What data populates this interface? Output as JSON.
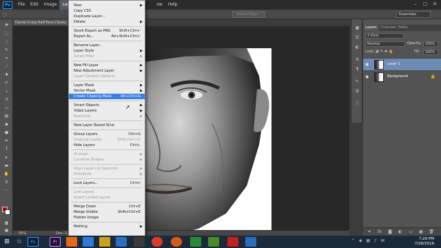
{
  "app": {
    "logo": "Ps",
    "menu": [
      "File",
      "Edit",
      "Image",
      "Layer",
      "",
      "ow",
      "Help"
    ],
    "active_menu": "Layer",
    "window_controls": [
      "–",
      "☐",
      "✕"
    ]
  },
  "options_bar": {
    "refine_edge": "Refine Edge...",
    "workspace": "Essentials"
  },
  "document": {
    "tab_title": "Daniel-Craig-Half-Face-Closeu",
    "zoom": "50%",
    "doc_size": "Doc: 3.29M"
  },
  "layer_menu": {
    "items": [
      {
        "label": "New",
        "shortcut": "",
        "submenu": true,
        "disabled": false
      },
      {
        "label": "Copy CSS",
        "shortcut": "",
        "submenu": false,
        "disabled": false
      },
      {
        "label": "Duplicate Layer...",
        "shortcut": "",
        "submenu": false,
        "disabled": false
      },
      {
        "label": "Delete",
        "shortcut": "",
        "submenu": true,
        "disabled": false
      },
      {
        "sep": true
      },
      {
        "label": "Quick Export as PNG",
        "shortcut": "Shift+Ctrl+'",
        "submenu": false,
        "disabled": false
      },
      {
        "label": "Export As...",
        "shortcut": "Alt+Shift+Ctrl+'",
        "submenu": false,
        "disabled": false
      },
      {
        "sep": true
      },
      {
        "label": "Rename Layer...",
        "shortcut": "",
        "submenu": false,
        "disabled": false
      },
      {
        "label": "Layer Style",
        "shortcut": "",
        "submenu": true,
        "disabled": false
      },
      {
        "label": "Smart Filter",
        "shortcut": "",
        "submenu": true,
        "disabled": true
      },
      {
        "sep": true
      },
      {
        "label": "New Fill Layer",
        "shortcut": "",
        "submenu": true,
        "disabled": false
      },
      {
        "label": "New Adjustment Layer",
        "shortcut": "",
        "submenu": true,
        "disabled": false
      },
      {
        "label": "Layer Content Options...",
        "shortcut": "",
        "submenu": false,
        "disabled": true
      },
      {
        "sep": true
      },
      {
        "label": "Layer Mask",
        "shortcut": "",
        "submenu": true,
        "disabled": false
      },
      {
        "label": "Vector Mask",
        "shortcut": "",
        "submenu": true,
        "disabled": false
      },
      {
        "label": "Create Clipping Mask",
        "shortcut": "Alt+Ctrl+G",
        "submenu": false,
        "disabled": false,
        "highlight": true
      },
      {
        "sep": true
      },
      {
        "label": "Smart Objects",
        "shortcut": "",
        "submenu": true,
        "disabled": false
      },
      {
        "label": "Video Layers",
        "shortcut": "",
        "submenu": true,
        "disabled": false
      },
      {
        "label": "Rasterize",
        "shortcut": "",
        "submenu": true,
        "disabled": true
      },
      {
        "sep": true
      },
      {
        "label": "New Layer Based Slice",
        "shortcut": "",
        "submenu": false,
        "disabled": false
      },
      {
        "sep": true
      },
      {
        "label": "Group Layers",
        "shortcut": "Ctrl+G",
        "submenu": false,
        "disabled": false
      },
      {
        "label": "Ungroup Layers",
        "shortcut": "Shift+Ctrl+G",
        "submenu": false,
        "disabled": true
      },
      {
        "label": "Hide Layers",
        "shortcut": "Ctrl+,",
        "submenu": false,
        "disabled": false
      },
      {
        "sep": true
      },
      {
        "label": "Arrange",
        "shortcut": "",
        "submenu": true,
        "disabled": true
      },
      {
        "label": "Combine Shapes",
        "shortcut": "",
        "submenu": true,
        "disabled": true
      },
      {
        "sep": true
      },
      {
        "label": "Align Layers to Selection",
        "shortcut": "",
        "submenu": true,
        "disabled": true
      },
      {
        "label": "Distribute",
        "shortcut": "",
        "submenu": true,
        "disabled": true
      },
      {
        "sep": true
      },
      {
        "label": "Lock Layers...",
        "shortcut": "Ctrl+/",
        "submenu": false,
        "disabled": false
      },
      {
        "sep": true
      },
      {
        "label": "Link Layers",
        "shortcut": "",
        "submenu": false,
        "disabled": true
      },
      {
        "label": "Select Linked Layers",
        "shortcut": "",
        "submenu": false,
        "disabled": true
      },
      {
        "sep": true
      },
      {
        "label": "Merge Down",
        "shortcut": "Ctrl+E",
        "submenu": false,
        "disabled": false
      },
      {
        "label": "Merge Visible",
        "shortcut": "Shift+Ctrl+E",
        "submenu": false,
        "disabled": false
      },
      {
        "label": "Flatten Image",
        "shortcut": "",
        "submenu": false,
        "disabled": false
      },
      {
        "sep": true
      },
      {
        "label": "Matting",
        "shortcut": "",
        "submenu": true,
        "disabled": false
      }
    ]
  },
  "layers_panel": {
    "tabs": [
      "Layers",
      "Channels",
      "Paths"
    ],
    "kind": "Kind",
    "blend_mode": "Normal",
    "opacity_label": "Opacity:",
    "opacity": "100%",
    "lock_label": "Lock:",
    "fill_label": "Fill:",
    "fill": "100%",
    "layers": [
      {
        "name": "Layer 1",
        "selected": true,
        "locked": false
      },
      {
        "name": "Background",
        "selected": false,
        "locked": true
      }
    ]
  },
  "taskbar": {
    "apps": [
      "⊞",
      "▢",
      "Ps",
      "Pr",
      "",
      "",
      "",
      "",
      "",
      "",
      "",
      "",
      "",
      "",
      ""
    ],
    "time": "7:29 PM",
    "date": "7/28/2016"
  },
  "colors": {
    "accent": "#3a80e0",
    "foreground": "#b80000",
    "background": "#ffffff"
  }
}
